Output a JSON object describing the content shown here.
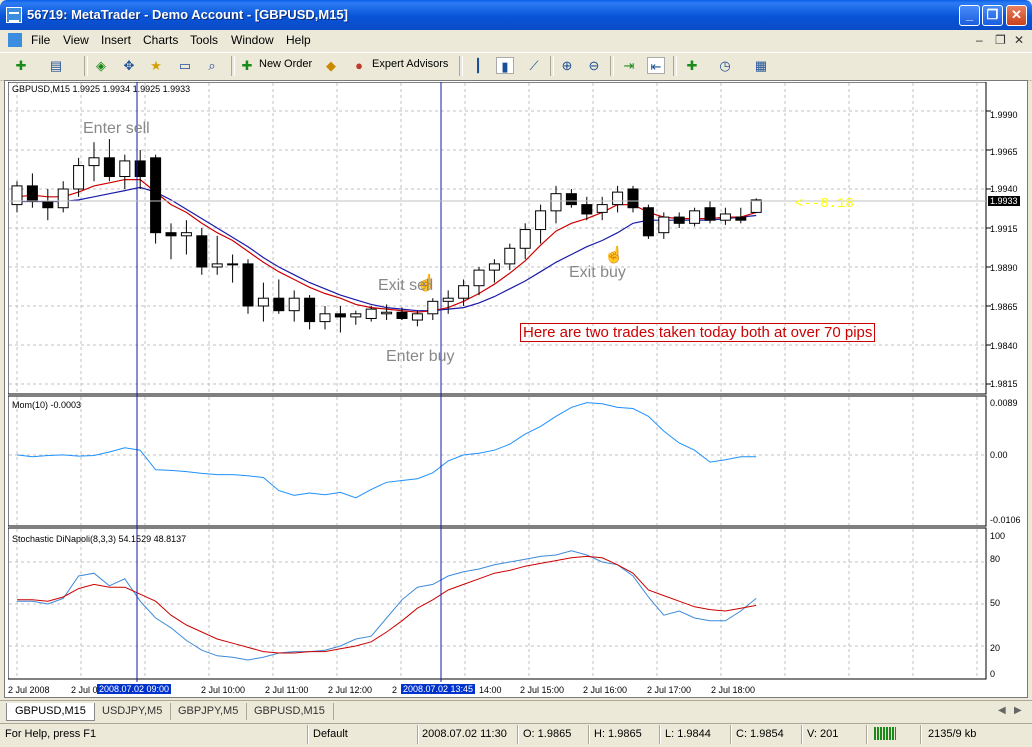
{
  "window": {
    "title": "56719: MetaTrader - Demo Account - [GBPUSD,M15]"
  },
  "menu": [
    "File",
    "View",
    "Insert",
    "Charts",
    "Tools",
    "Window",
    "Help"
  ],
  "toolbar": {
    "new_order": "New Order",
    "expert_advisors": "Expert Advisors"
  },
  "chart": {
    "symbol_line": "GBPUSD,M15  1.9925 1.9934 1.9925 1.9933",
    "price_ticks": [
      "1.9990",
      "1.9965",
      "1.9940",
      "1.9915",
      "1.9890",
      "1.9865",
      "1.9840",
      "1.9815"
    ],
    "current_price": "1.9933",
    "spread_label": "<--8.18",
    "annotations": {
      "enter_sell": "Enter sell",
      "exit_sell": "Exit sell",
      "enter_buy": "Enter buy",
      "exit_buy": "Exit buy",
      "note": "Here are two trades taken today both at over 70 pips"
    },
    "momentum": {
      "label": "Mom(10) -0.0003",
      "ticks": [
        "0.0089",
        "0.00",
        "-0.0106"
      ]
    },
    "stochastic": {
      "label": "Stochastic DiNapoli(8,3,3) 54.1529 48.8137",
      "ticks": [
        "100",
        "80",
        "50",
        "20",
        "0"
      ]
    },
    "time_labels": [
      "2 Jul 2008",
      "2 Jul 0",
      "2 Jul 10:00",
      "2 Jul 11:00",
      "2 Jul 12:00",
      "2 ",
      "14:00",
      "2 Jul 15:00",
      "2 Jul 16:00",
      "2 Jul 17:00",
      "2 Jul 18:00"
    ],
    "crosshair_labels": [
      "2008.07.02 09:00",
      "2008.07.02 13:45"
    ]
  },
  "chart_data": {
    "type": "candlestick",
    "symbol": "GBPUSD",
    "timeframe": "M15",
    "ohlc": [
      [
        1.993,
        1.9945,
        1.9925,
        1.9942
      ],
      [
        1.9942,
        1.995,
        1.9928,
        1.9932
      ],
      [
        1.9932,
        1.994,
        1.992,
        1.9928
      ],
      [
        1.9928,
        1.9945,
        1.9925,
        1.994
      ],
      [
        1.994,
        1.996,
        1.9935,
        1.9955
      ],
      [
        1.9955,
        1.997,
        1.9945,
        1.996
      ],
      [
        1.996,
        1.9972,
        1.9945,
        1.9948
      ],
      [
        1.9948,
        1.9962,
        1.994,
        1.9958
      ],
      [
        1.9958,
        1.9965,
        1.994,
        1.9948
      ],
      [
        1.996,
        1.9962,
        1.9905,
        1.9912
      ],
      [
        1.9912,
        1.9918,
        1.9895,
        1.991
      ],
      [
        1.991,
        1.992,
        1.9898,
        1.9912
      ],
      [
        1.991,
        1.9915,
        1.9885,
        1.989
      ],
      [
        1.989,
        1.991,
        1.9885,
        1.9892
      ],
      [
        1.9892,
        1.9898,
        1.988,
        1.9892
      ],
      [
        1.9892,
        1.9895,
        1.986,
        1.9865
      ],
      [
        1.9865,
        1.988,
        1.9855,
        1.987
      ],
      [
        1.987,
        1.9882,
        1.986,
        1.9862
      ],
      [
        1.9862,
        1.9875,
        1.9855,
        1.987
      ],
      [
        1.987,
        1.9872,
        1.985,
        1.9855
      ],
      [
        1.9855,
        1.9865,
        1.985,
        1.986
      ],
      [
        1.986,
        1.9865,
        1.9848,
        1.9858
      ],
      [
        1.9858,
        1.9862,
        1.9853,
        1.986
      ],
      [
        1.9857,
        1.9865,
        1.9855,
        1.9863
      ],
      [
        1.986,
        1.9866,
        1.9856,
        1.9861
      ],
      [
        1.9861,
        1.9864,
        1.9856,
        1.9857
      ],
      [
        1.9856,
        1.9862,
        1.9852,
        1.986
      ],
      [
        1.986,
        1.987,
        1.9856,
        1.9868
      ],
      [
        1.9868,
        1.9875,
        1.986,
        1.987
      ],
      [
        1.987,
        1.9882,
        1.9865,
        1.9878
      ],
      [
        1.9878,
        1.989,
        1.9872,
        1.9888
      ],
      [
        1.9888,
        1.9895,
        1.988,
        1.9892
      ],
      [
        1.9892,
        1.9905,
        1.9888,
        1.9902
      ],
      [
        1.9902,
        1.9918,
        1.9895,
        1.9914
      ],
      [
        1.9914,
        1.993,
        1.9905,
        1.9926
      ],
      [
        1.9926,
        1.9942,
        1.9918,
        1.9937
      ],
      [
        1.9937,
        1.994,
        1.9928,
        1.993
      ],
      [
        1.993,
        1.9935,
        1.992,
        1.9924
      ],
      [
        1.9925,
        1.9935,
        1.992,
        1.993
      ],
      [
        1.993,
        1.9942,
        1.9925,
        1.9938
      ],
      [
        1.994,
        1.9942,
        1.9925,
        1.9928
      ],
      [
        1.9928,
        1.993,
        1.9908,
        1.991
      ],
      [
        1.9912,
        1.9925,
        1.9908,
        1.9922
      ],
      [
        1.9922,
        1.9925,
        1.9915,
        1.9918
      ],
      [
        1.9918,
        1.9928,
        1.9916,
        1.9926
      ],
      [
        1.9928,
        1.9932,
        1.9918,
        1.992
      ],
      [
        1.992,
        1.9928,
        1.9917,
        1.9924
      ],
      [
        1.9922,
        1.9928,
        1.9918,
        1.992
      ],
      [
        1.9925,
        1.9934,
        1.9925,
        1.9933
      ]
    ],
    "ma_red": [
      1.9935,
      1.9936,
      1.9935,
      1.9935,
      1.9938,
      1.9942,
      1.9944,
      1.9946,
      1.9946,
      1.9938,
      1.993,
      1.9925,
      1.9918,
      1.9912,
      1.9907,
      1.99,
      1.9893,
      1.9887,
      1.9882,
      1.9877,
      1.9873,
      1.987,
      1.9866,
      1.9864,
      1.9863,
      1.9862,
      1.9861,
      1.9862,
      1.9864,
      1.9868,
      1.9873,
      1.9879,
      1.9886,
      1.9894,
      1.9904,
      1.9913,
      1.9918,
      1.9921,
      1.9925,
      1.993,
      1.993,
      1.9925,
      1.9922,
      1.9921,
      1.9921,
      1.9921,
      1.9922,
      1.9922,
      1.9925
    ],
    "ma_blue": [
      1.9932,
      1.9932,
      1.9932,
      1.9932,
      1.9933,
      1.9935,
      1.9937,
      1.9939,
      1.9941,
      1.9938,
      1.9933,
      1.9927,
      1.9921,
      1.9915,
      1.9909,
      1.9903,
      1.9896,
      1.989,
      1.9885,
      1.988,
      1.9876,
      1.9872,
      1.9869,
      1.9866,
      1.9864,
      1.9863,
      1.9862,
      1.9862,
      1.9863,
      1.9864,
      1.9867,
      1.9871,
      1.9876,
      1.9881,
      1.9887,
      1.9893,
      1.9898,
      1.9903,
      1.9907,
      1.9912,
      1.9918,
      1.992,
      1.992,
      1.992,
      1.992,
      1.992,
      1.9921,
      1.9922,
      1.9923
    ],
    "momentum": [
      0.0,
      -0.0003,
      -0.0001,
      0.0,
      -0.0002,
      -0.0001,
      0.0005,
      0.0012,
      0.0008,
      -0.0025,
      -0.0026,
      -0.0028,
      -0.0031,
      -0.0033,
      -0.0033,
      -0.0035,
      -0.0038,
      -0.006,
      -0.0068,
      -0.0064,
      -0.0067,
      -0.0063,
      -0.0072,
      -0.0058,
      -0.0046,
      -0.0043,
      -0.004,
      -0.003,
      -0.001,
      0.0,
      0.0003,
      0.0008,
      0.0018,
      0.0035,
      0.0048,
      0.0065,
      0.008,
      0.0088,
      0.0086,
      0.008,
      0.0078,
      0.0065,
      0.004,
      0.002,
      0.0008,
      -0.0012,
      -0.0008,
      -0.0003,
      -0.0003
    ],
    "stoch_k": [
      52,
      52,
      50,
      54,
      70,
      72,
      63,
      68,
      52,
      40,
      33,
      24,
      17,
      13,
      12,
      10,
      12,
      15,
      16,
      16,
      17,
      20,
      25,
      27,
      40,
      53,
      62,
      64,
      70,
      73,
      75,
      78,
      80,
      82,
      84,
      85,
      88,
      85,
      80,
      78,
      70,
      55,
      42,
      45,
      40,
      38,
      38,
      45,
      54
    ],
    "stoch_d": [
      53,
      53,
      52,
      55,
      61,
      64,
      62,
      62,
      57,
      52,
      42,
      35,
      30,
      25,
      22,
      19,
      16,
      15,
      15,
      16,
      16,
      18,
      20,
      23,
      30,
      38,
      47,
      53,
      60,
      64,
      68,
      72,
      74,
      77,
      79,
      81,
      83,
      84,
      83,
      78,
      72,
      60,
      56,
      52,
      48,
      46,
      45,
      47,
      49
    ],
    "price_axis_range": [
      1.9815,
      1.999
    ],
    "momentum_axis_range": [
      -0.0106,
      0.0089
    ],
    "stoch_axis_range": [
      0,
      100
    ],
    "colors": {
      "bull_candle": "#ffffff",
      "bear_candle": "#000000",
      "ma_red": "#cc0000",
      "ma_blue": "#1a1aa8",
      "momentum": "#1e90ff",
      "stoch_k": "#3d8bd8",
      "stoch_d": "#cc0000",
      "grid": "#c0c0c0",
      "annotation_text": "#888888",
      "note_text": "#cc0000",
      "spread_text": "#ffff00"
    }
  },
  "tabs": [
    "GBPUSD,M15",
    "USDJPY,M5",
    "GBPJPY,M5",
    "GBPUSD,M15"
  ],
  "status": {
    "help": "For Help, press F1",
    "profile": "Default",
    "datetime": "2008.07.02 11:30",
    "open": "O: 1.9865",
    "high": "H: 1.9865",
    "low": "L: 1.9844",
    "close": "C: 1.9854",
    "volume": "V: 201",
    "traffic": "2135/9 kb"
  }
}
